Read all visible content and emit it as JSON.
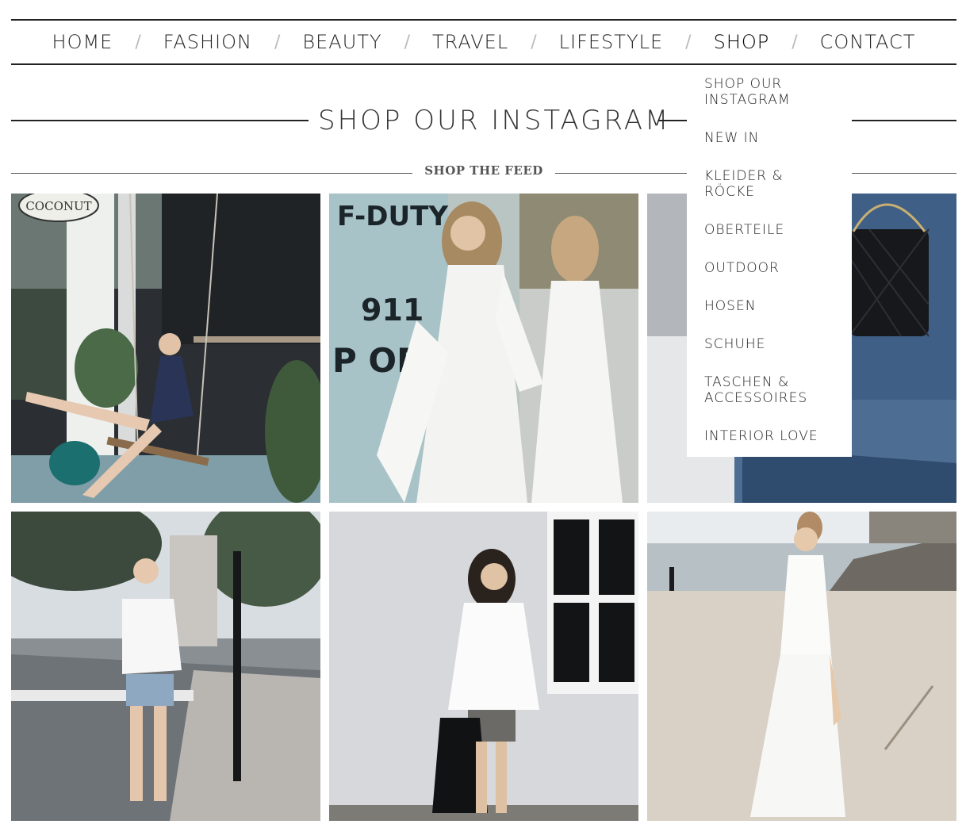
{
  "nav": {
    "items": [
      {
        "label": "HOME"
      },
      {
        "label": "FASHION"
      },
      {
        "label": "BEAUTY"
      },
      {
        "label": "TRAVEL"
      },
      {
        "label": "LIFESTYLE"
      },
      {
        "label": "SHOP"
      },
      {
        "label": "CONTACT"
      }
    ],
    "separator": "/",
    "active": "SHOP"
  },
  "page": {
    "title": "SHOP OUR INSTAGRAM",
    "subtitle": "SHOP THE FEED"
  },
  "dropdown": {
    "items": [
      {
        "label": "SHOP OUR INSTAGRAM"
      },
      {
        "label": "NEW IN"
      },
      {
        "label": "KLEIDER & RÖCKE"
      },
      {
        "label": "OBERTEILE"
      },
      {
        "label": "OUTDOOR"
      },
      {
        "label": "HOSEN"
      },
      {
        "label": "SCHUHE"
      },
      {
        "label": "TASCHEN & ACCESSOIRES"
      },
      {
        "label": "INTERIOR LOVE"
      }
    ]
  },
  "feed": {
    "photos": [
      {
        "sign_text": "COCONUT",
        "icon": "photo-swing-icon"
      },
      {
        "sign_text": "F-DUTY",
        "sign_text_2": "911",
        "sign_text_3": "P OFF",
        "icon": "photo-white-dress-icon"
      },
      {
        "icon": "photo-denim-bag-icon"
      },
      {
        "icon": "photo-street-icon"
      },
      {
        "icon": "photo-wall-icon"
      },
      {
        "icon": "photo-beach-icon"
      }
    ]
  },
  "colors": {
    "text": "#222222",
    "separator": "#bbbbbb",
    "line": "#222222"
  }
}
